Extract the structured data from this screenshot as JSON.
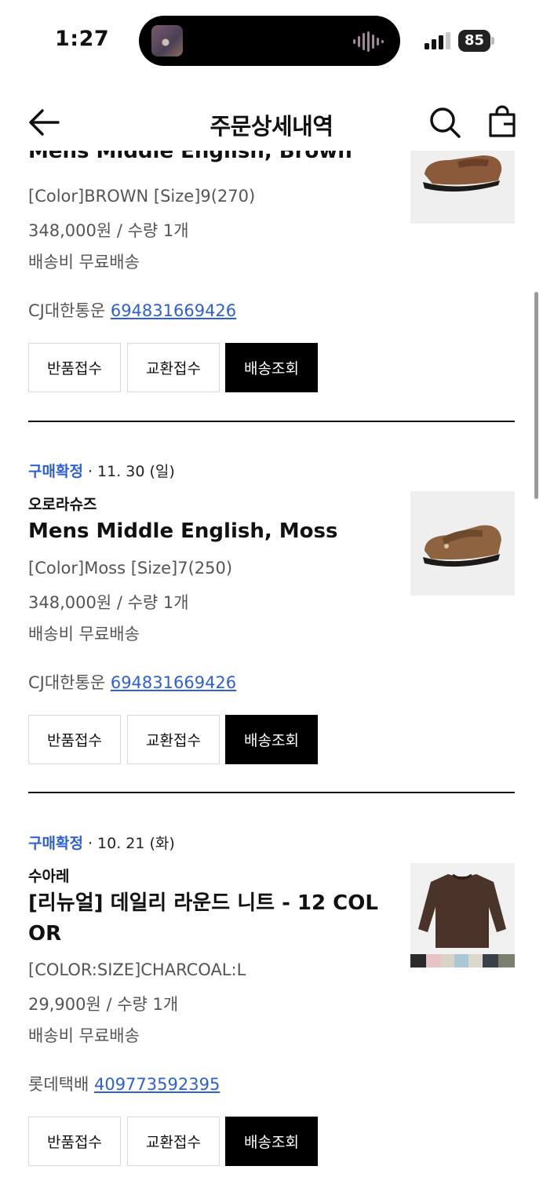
{
  "status_bar": {
    "time": "1:27",
    "battery": "85"
  },
  "header": {
    "title": "주문상세내역"
  },
  "orders": [
    {
      "status": "",
      "date": "",
      "brand": "",
      "name": "Mens Middle English, Brown",
      "option": "[Color]BROWN [Size]9(270)",
      "price": "348,000원 / 수량 1개",
      "shipping": "배송비 무료배송",
      "courier": "CJ대한통운",
      "tracking": "694831669426"
    },
    {
      "status": "구매확정",
      "date": " · 11. 30 (일)",
      "brand": "오로라슈즈",
      "name": "Mens Middle English, Moss",
      "option": "[Color]Moss [Size]7(250)",
      "price": "348,000원 / 수량 1개",
      "shipping": "배송비 무료배송",
      "courier": "CJ대한통운",
      "tracking": "694831669426"
    },
    {
      "status": "구매확정",
      "date": " · 10. 21 (화)",
      "brand": "수아레",
      "name": "[리뉴얼] 데일리 라운드 니트 - 12 COLOR",
      "option": "[COLOR:SIZE]CHARCOAL:L",
      "price": "29,900원 / 수량 1개",
      "shipping": "배송비 무료배송",
      "courier": "롯데택배",
      "tracking": "409773592395"
    }
  ],
  "buttons": {
    "return": "반품접수",
    "exchange": "교환접수",
    "track": "배송조회"
  },
  "colors": {
    "accent": "#2d5fd8",
    "text": "#111111",
    "muted": "#555555"
  }
}
